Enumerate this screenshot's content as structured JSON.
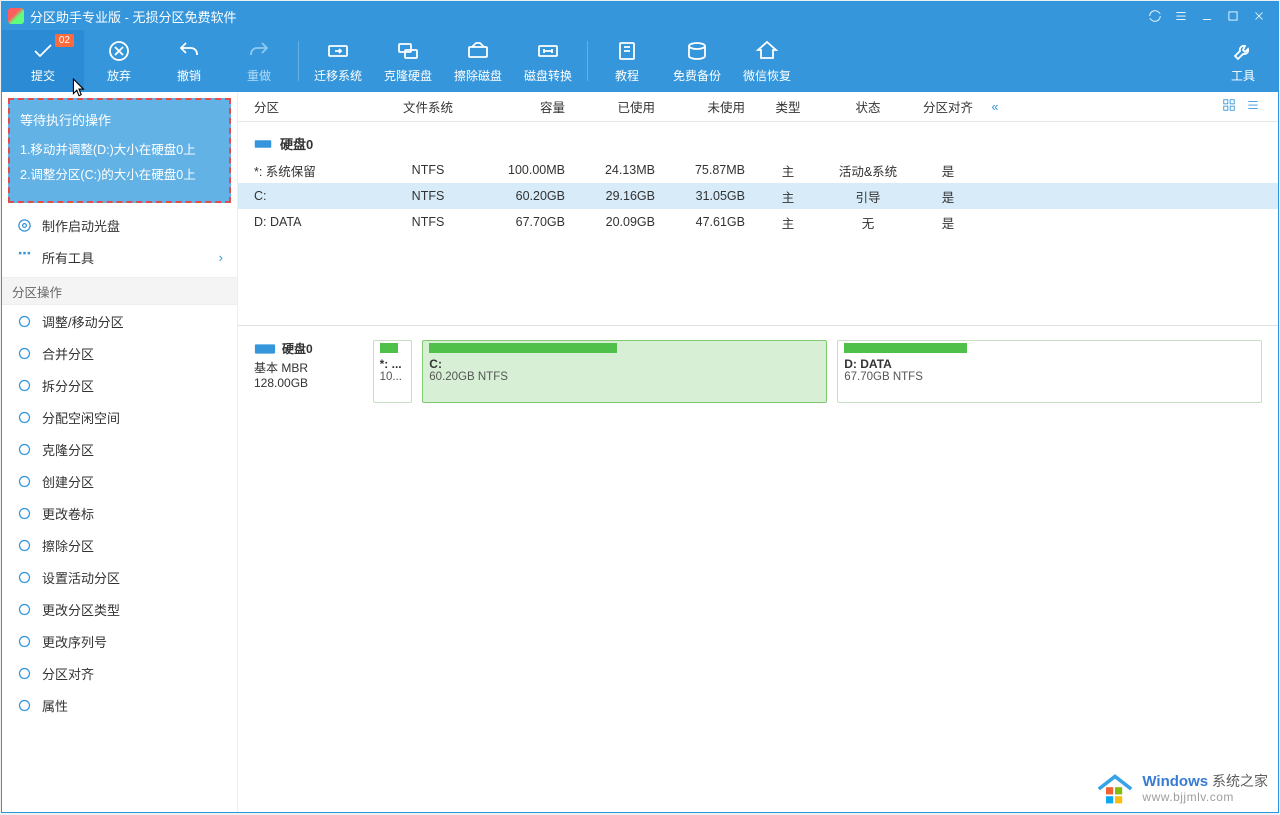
{
  "title": "分区助手专业版 - 无损分区免费软件",
  "toolbar": {
    "commit": "提交",
    "commit_badge": "02",
    "discard": "放弃",
    "undo": "撤销",
    "redo": "重做",
    "migrate": "迁移系统",
    "clone": "克隆硬盘",
    "wipe": "擦除磁盘",
    "convert": "磁盘转换",
    "tutorial": "教程",
    "backup": "免费备份",
    "wechat": "微信恢复",
    "tools": "工具"
  },
  "pending": {
    "title": "等待执行的操作",
    "items": [
      "1.移动并调整(D:)大小在硬盘0上",
      "2.调整分区(C:)的大小在硬盘0上"
    ]
  },
  "side_top": [
    {
      "label": "制作启动光盘"
    },
    {
      "label": "所有工具"
    }
  ],
  "side_ops_hdr": "分区操作",
  "side_ops": [
    "调整/移动分区",
    "合并分区",
    "拆分分区",
    "分配空闲空间",
    "克隆分区",
    "创建分区",
    "更改卷标",
    "擦除分区",
    "设置活动分区",
    "更改分区类型",
    "更改序列号",
    "分区对齐",
    "属性"
  ],
  "columns": [
    "分区",
    "文件系统",
    "容量",
    "已使用",
    "未使用",
    "类型",
    "状态",
    "分区对齐"
  ],
  "disk_label": "硬盘0",
  "rows": [
    {
      "part": "*: 系统保留",
      "fs": "NTFS",
      "cap": "100.00MB",
      "used": "24.13MB",
      "free": "75.87MB",
      "type": "主",
      "stat": "活动&系统",
      "align": "是"
    },
    {
      "part": "C:",
      "fs": "NTFS",
      "cap": "60.20GB",
      "used": "29.16GB",
      "free": "31.05GB",
      "type": "主",
      "stat": "引导",
      "align": "是",
      "sel": true
    },
    {
      "part": "D: DATA",
      "fs": "NTFS",
      "cap": "67.70GB",
      "used": "20.09GB",
      "free": "47.61GB",
      "type": "主",
      "stat": "无",
      "align": "是"
    }
  ],
  "vis": {
    "disk": {
      "name": "硬盘0",
      "type": "基本 MBR",
      "size": "128.00GB"
    },
    "small": {
      "lab": "*: ...",
      "sub": "10..."
    },
    "c1": {
      "lab": "C:",
      "sub": "60.20GB NTFS"
    },
    "c2": {
      "lab": "D: DATA",
      "sub": "67.70GB NTFS"
    }
  },
  "watermark": {
    "l1a": "Windows",
    "l1b": " 系统之家",
    "l2": "www.bjjmlv.com"
  }
}
